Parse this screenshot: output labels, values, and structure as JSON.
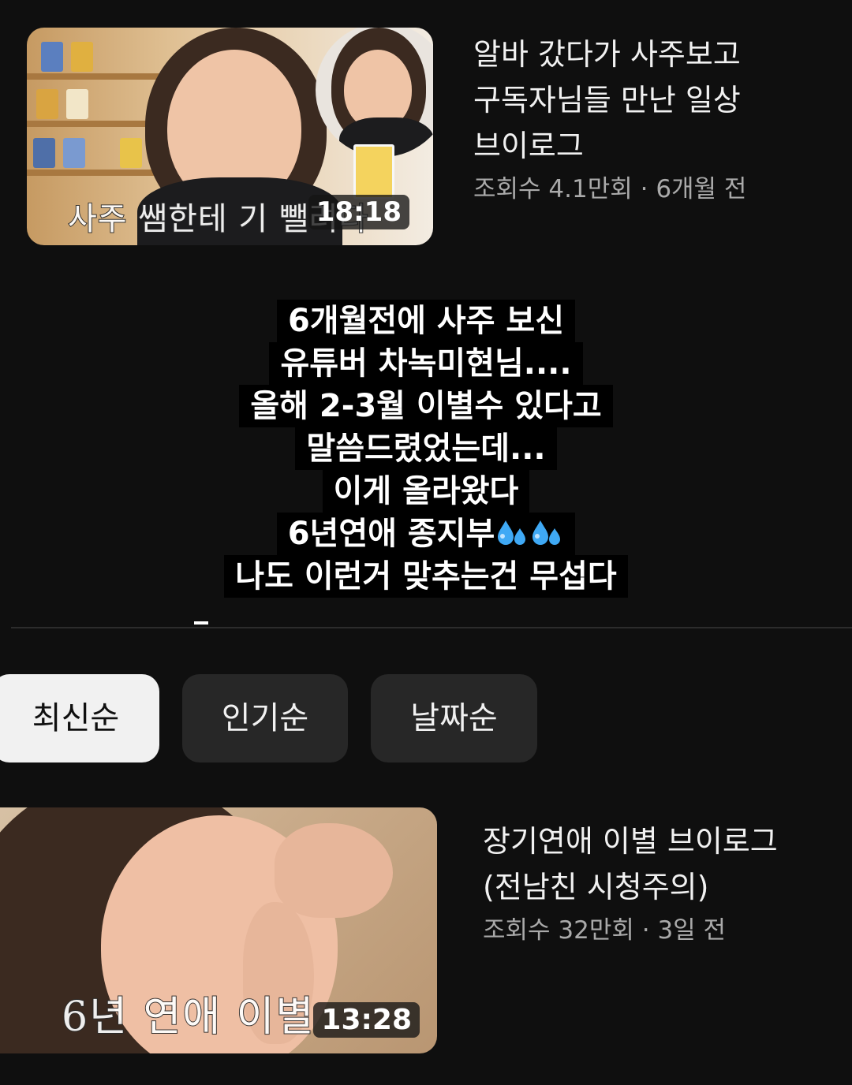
{
  "videos": [
    {
      "title_line1": "알바 갔다가 사주보고",
      "title_line2": "구독자님들 만난 일상",
      "title_line3": "브이로그",
      "stats": "조회수 4.1만회 · 6개월 전",
      "duration": "18:18",
      "thumbnail_caption": "사주 쌤한테 기 뺄려다"
    },
    {
      "title_line1": "장기연애 이별 브이로그",
      "title_line2": "(전남친 시청주의)",
      "stats": "조회수 32만회 · 3일 전",
      "duration": "13:28",
      "thumbnail_caption": "6년 연애 이별"
    }
  ],
  "story_text": {
    "lines": [
      "6개월전에 사주 보신",
      "유튜버 차녹미현님....",
      "올해 2-3월 이별수 있다고",
      "말씀드렸었는데...",
      "이게 올라왔다",
      "6년연애 종지부",
      "나도 이런거 맞추는건 무섭다"
    ],
    "emoji": "sweat-droplets-icon"
  },
  "sort_chips": {
    "items": [
      {
        "label": "최신순",
        "active": true
      },
      {
        "label": "인기순",
        "active": false
      },
      {
        "label": "날짜순",
        "active": false
      }
    ]
  },
  "colors": {
    "background": "#0f0f0f",
    "chip_active_bg": "#f1f1f1",
    "chip_bg": "#272727",
    "stats_text": "#aaaaaa",
    "emoji_blue": "#3fa9f5"
  }
}
